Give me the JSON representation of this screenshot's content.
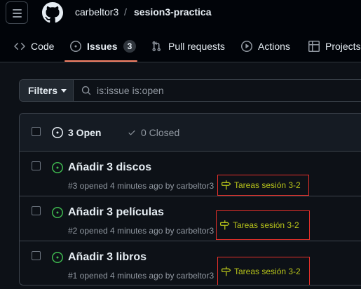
{
  "header": {
    "owner": "carbeltor3",
    "separator": "/",
    "repo": "sesion3-practica"
  },
  "tabs": [
    {
      "label": "Code",
      "icon": "code-icon"
    },
    {
      "label": "Issues",
      "icon": "issue-opened-icon",
      "count": "3",
      "selected": true
    },
    {
      "label": "Pull requests",
      "icon": "git-pull-request-icon"
    },
    {
      "label": "Actions",
      "icon": "play-icon"
    },
    {
      "label": "Projects",
      "icon": "table-icon"
    }
  ],
  "filter": {
    "button_label": "Filters",
    "query": "is:issue is:open"
  },
  "list_header": {
    "open_label": "3 Open",
    "closed_label": "0 Closed"
  },
  "issues": [
    {
      "title": "Añadir 3 discos",
      "meta": "#3 opened 4 minutes ago by carbeltor3",
      "milestone": "Tareas sesión 3-2"
    },
    {
      "title": "Añadir 3 películas",
      "meta": "#2 opened 4 minutes ago by carbeltor3",
      "milestone": "Tareas sesión 3-2"
    },
    {
      "title": "Añadir 3 libros",
      "meta": "#1 opened 4 minutes ago by carbeltor3",
      "milestone": "Tareas sesión 3-2"
    }
  ],
  "colors": {
    "background": "#0d1117",
    "accent_underline": "#f78166",
    "open_green": "#3fb950",
    "milestone_text": "#b6c21a",
    "annotation_red": "#e5302a"
  }
}
